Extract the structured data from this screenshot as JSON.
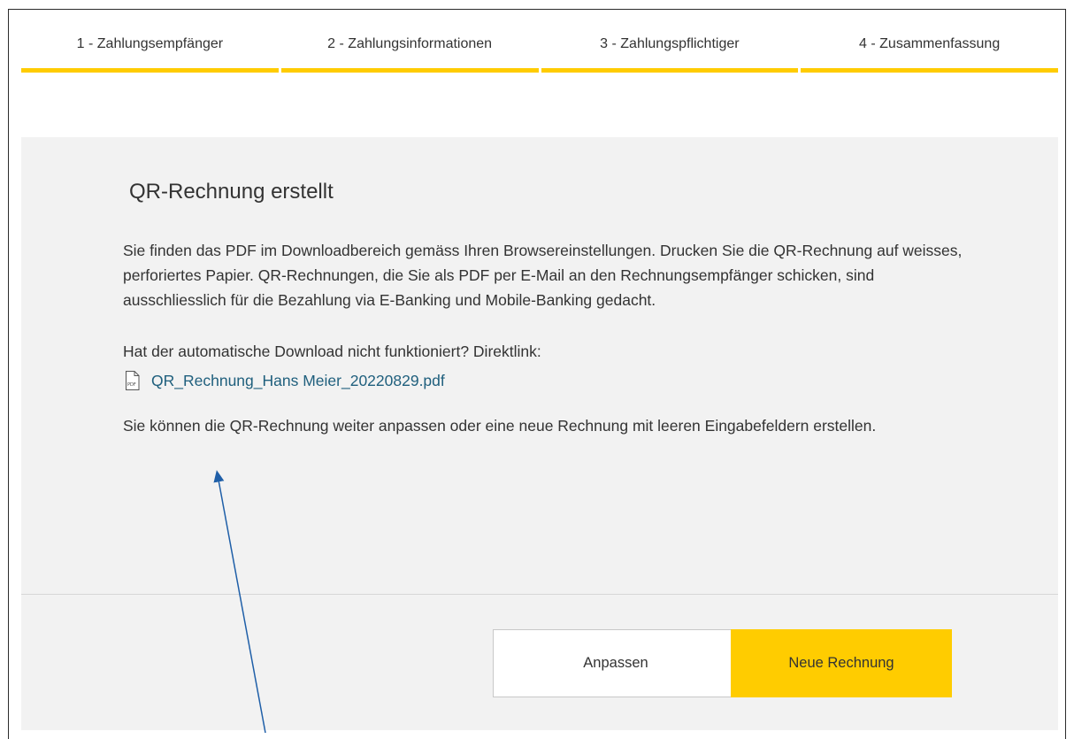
{
  "stepper": {
    "steps": [
      {
        "label": "1 - Zahlungsempfänger"
      },
      {
        "label": "2 - Zahlungsinformationen"
      },
      {
        "label": "3 - Zahlungspflichtiger"
      },
      {
        "label": "4 - Zusammenfassung"
      }
    ],
    "accent_color": "#ffcc00"
  },
  "panel": {
    "title": "QR-Rechnung erstellt",
    "info_text": "Sie finden das PDF im Downloadbereich gemäss Ihren Browsereinstellungen. Drucken Sie die QR-Rechnung auf weisses, perforiertes Papier. QR-Rechnungen, die Sie als PDF per E-Mail an den Rechnungsempfänger schicken, sind ausschliesslich für die Bezahlung via E-Banking und Mobile-Banking gedacht.",
    "download_question": "Hat der automatische Download nicht funktioniert? Direktlink:",
    "file": {
      "icon": "pdf-file-icon",
      "icon_label": "PDF",
      "link_text": "QR_Rechnung_Hans Meier_20220829.pdf",
      "link_color": "#1f5f7d"
    },
    "adjust_text": "Sie können die QR-Rechnung weiter anpassen oder eine neue Rechnung mit leeren Eingabefeldern erstellen."
  },
  "actions": {
    "adjust_label": "Anpassen",
    "new_invoice_label": "Neue Rechnung",
    "primary_color": "#ffcc00"
  },
  "annotation": {
    "arrow_color": "#1f5fa8"
  }
}
